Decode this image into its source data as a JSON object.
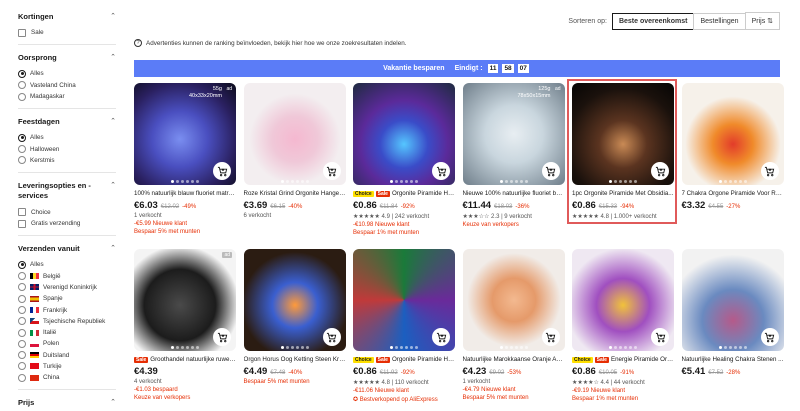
{
  "sidebar": {
    "sections": [
      {
        "title": "Kortingen",
        "type": "check",
        "items": [
          {
            "label": "Sale",
            "on": false
          }
        ]
      },
      {
        "title": "Oorsprong",
        "type": "radio",
        "items": [
          {
            "label": "Alles",
            "on": true
          },
          {
            "label": "Vasteland China",
            "on": false
          },
          {
            "label": "Madagaskar",
            "on": false
          }
        ]
      },
      {
        "title": "Feestdagen",
        "type": "radio",
        "items": [
          {
            "label": "Alles",
            "on": true
          },
          {
            "label": "Halloween",
            "on": false
          },
          {
            "label": "Kerstmis",
            "on": false
          }
        ]
      },
      {
        "title": "Leveringsopties en -services",
        "type": "check",
        "items": [
          {
            "label": "Choice",
            "on": false
          },
          {
            "label": "Gratis verzending",
            "on": false
          }
        ]
      },
      {
        "title": "Verzenden vanuit",
        "type": "radio",
        "items": [
          {
            "label": "Alles",
            "on": true,
            "flag": ""
          },
          {
            "label": "België",
            "on": false,
            "flag": "be"
          },
          {
            "label": "Verenigd Koninkrijk",
            "on": false,
            "flag": "uk"
          },
          {
            "label": "Spanje",
            "on": false,
            "flag": "es"
          },
          {
            "label": "Frankrijk",
            "on": false,
            "flag": "fr"
          },
          {
            "label": "Tsjechische Republiek",
            "on": false,
            "flag": "cz"
          },
          {
            "label": "Italië",
            "on": false,
            "flag": "it"
          },
          {
            "label": "Polen",
            "on": false,
            "flag": "pl"
          },
          {
            "label": "Duitsland",
            "on": false,
            "flag": "de"
          },
          {
            "label": "Turkije",
            "on": false,
            "flag": "tr"
          },
          {
            "label": "China",
            "on": false,
            "flag": "cn"
          }
        ]
      },
      {
        "title": "Prijs",
        "type": "none",
        "items": []
      }
    ]
  },
  "sort": {
    "label": "Sorteren op:",
    "options": [
      "Beste overeenkomst",
      "Bestellingen",
      "Prijs ⇅"
    ],
    "active_index": 0
  },
  "notice": "Advertenties kunnen de ranking beïnvloeden, bekijk hier hoe we onze zoekresultaten indelen.",
  "banner": {
    "title": "Vakantie besparen",
    "ends_label": "Eindigt :",
    "hours": "11",
    "minutes": "58",
    "seconds": "07"
  },
  "products": [
    {
      "title": "100% natuurlijk blauw fluoriet matrix...",
      "badges": [],
      "price": "€6.03",
      "old": "€12.02",
      "disc": "-49%",
      "info": "1 verkocht",
      "red": [
        "-€5.99  Nieuwe klant",
        "Bespaar 5% met munten"
      ],
      "img": "blue",
      "size": "55g\n40x33x20mm",
      "ad": "ad"
    },
    {
      "title": "Roze Kristal Grind Orgonite Hanger ...",
      "badges": [],
      "price": "€3.69",
      "old": "€6.15",
      "disc": "-40%",
      "info": "6 verkocht",
      "red": [],
      "img": "pink",
      "size": "",
      "ad": ""
    },
    {
      "title": "Orgonite Piramide Heali...",
      "badges": [
        "Choice",
        "Sale"
      ],
      "price": "€0.86",
      "old": "€11.84",
      "disc": "-92%",
      "info": "★★★★★ 4.9 | 242 verkocht",
      "red": [
        "-€10.98  Nieuwe klant",
        "Bespaar 1% met munten"
      ],
      "img": "purple",
      "size": "",
      "ad": ""
    },
    {
      "title": "Nieuwe 100% natuurlijke fluoriet bol...",
      "badges": [],
      "price": "€11.44",
      "old": "€18.03",
      "disc": "-36%",
      "info": "★★★☆☆ 2.3 | 9 verkocht",
      "red": [
        "Keuze van verkopers"
      ],
      "img": "white",
      "size": "125g\n78x50x15mm",
      "ad": "ad"
    },
    {
      "title": "1pc Orgonite Piramide Met Obsidia...",
      "badges": [],
      "price": "€0.86",
      "old": "€15.33",
      "disc": "-94%",
      "info": "★★★★★ 4.8 | 1.000+ verkocht",
      "red": [],
      "img": "brown",
      "size": "",
      "ad": ""
    },
    {
      "title": "7 Chakra Orgone Piramide Voor Rei...",
      "badges": [],
      "price": "€3.32",
      "old": "€4.55",
      "disc": "-27%",
      "info": "",
      "red": [],
      "img": "rainbow",
      "size": "",
      "ad": ""
    },
    {
      "title": "Groothandel natuurlijke ruwe z...",
      "badges": [
        "Sale"
      ],
      "price": "€4.39",
      "old": "",
      "disc": "",
      "info": "4 verkocht",
      "red": [
        "-€1.03 bespaard",
        "Keuze van verkopers"
      ],
      "img": "black",
      "size": "",
      "ad": "ad"
    },
    {
      "title": "Orgon Horus Oog Ketting Steen Kri...",
      "badges": [],
      "price": "€4.49",
      "old": "€7.48",
      "disc": "-40%",
      "info": "",
      "red": [
        "Bespaar 5% met munten"
      ],
      "img": "pendant",
      "size": "",
      "ad": ""
    },
    {
      "title": "Orgonite Piramide Heali...",
      "badges": [
        "Choice",
        "Sale"
      ],
      "price": "€0.86",
      "old": "€11.92",
      "disc": "-92%",
      "info": "★★★★★ 4.8 | 110 verkocht",
      "red": [
        "-€11.06  Nieuwe klant",
        "✪ Bestverkopend op AliExpress"
      ],
      "img": "multi",
      "size": "",
      "ad": ""
    },
    {
      "title": "Natuurlijke Marokkaanse Oranje Ara...",
      "badges": [],
      "price": "€4.23",
      "old": "€9.02",
      "disc": "-53%",
      "info": "1 verkocht",
      "red": [
        "-€4.79  Nieuwe klant",
        "Bespaar 5% met munten"
      ],
      "img": "orange",
      "size": "",
      "ad": ""
    },
    {
      "title": "Energie Piramide Orgoni...",
      "badges": [
        "Choice",
        "Sale"
      ],
      "price": "€0.86",
      "old": "€10.05",
      "disc": "-91%",
      "info": "★★★★☆ 4.4 | 44 verkocht",
      "red": [
        "-€9.19  Nieuwe klant",
        "Bespaar 1% met munten"
      ],
      "img": "violet",
      "size": "",
      "ad": ""
    },
    {
      "title": "Natuurlijke Healing Chakra Stenen ...",
      "badges": [],
      "price": "€5.41",
      "old": "€7.52",
      "disc": "-28%",
      "info": "",
      "red": [],
      "img": "stones",
      "size": "",
      "ad": ""
    }
  ]
}
